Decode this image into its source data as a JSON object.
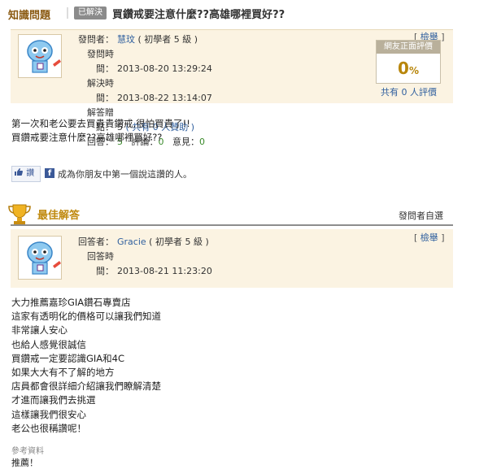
{
  "question": {
    "section_tag": "知識問題",
    "status_badge": "已解決",
    "title": "買鑽戒要注意什麼??高雄哪裡買好??",
    "report_label": "檢舉",
    "asker_label": "發問者：",
    "asker_name": "慧玟",
    "asker_level": "( 初學者 5 級 )",
    "posted_label": "發問時間：",
    "posted_time": "2013-08-20 13:29:24",
    "resolved_label": "解決時間：",
    "resolved_time": "2013-08-22 13:14:07",
    "points_label": "解答贈點：",
    "points_value": "5",
    "points_extra": "( 共有 0 人贊助 )",
    "answers_label": "回答：",
    "answers_count": "5",
    "comments_label": "評論：",
    "comments_count": "0",
    "opinions_label": "意見：",
    "opinions_count": "0",
    "rating_header": "網友正面評價",
    "rating_percent": "0",
    "rating_unit": "%",
    "rating_count_text": "共有 0 人評價",
    "body_lines": [
      "第一次和老公要去買貴貴鑽戒,很怕買貴了!!",
      "買鑽戒要注意什麼??高雄哪裡買好??"
    ],
    "like_label": "讚",
    "fb_text": "成為你朋友中第一個說這讚的人。"
  },
  "best_answer": {
    "heading": "最佳解答",
    "selected_by": "發問者自選",
    "report_label": "檢舉",
    "answerer_label": "回答者：",
    "answerer_name": "Gracie",
    "answerer_level": "( 初學者 5 級 )",
    "answered_label": "回答時間：",
    "answered_time": "2013-08-21 11:23:20",
    "body_lines": [
      "大力推薦嘉珍GIA鑽石專賣店",
      "這家有透明化的價格可以讓我們知道",
      "非常讓人安心",
      "也給人感覺很誠信",
      "買鑽戒一定要認識GIA和4C",
      "如果大大有不了解的地方",
      "店員都會很詳細介紹讓我們瞭解清楚",
      "才進而讓我們去挑選",
      "這樣讓我們很安心",
      "老公也很稱讚呢！"
    ],
    "reference_label": "參考資料",
    "reference_text": "推薦！"
  },
  "colors": {
    "panel_bg": "#fbf3e2",
    "accent_gold": "#c08a10",
    "link_blue": "#2f5f9e"
  }
}
